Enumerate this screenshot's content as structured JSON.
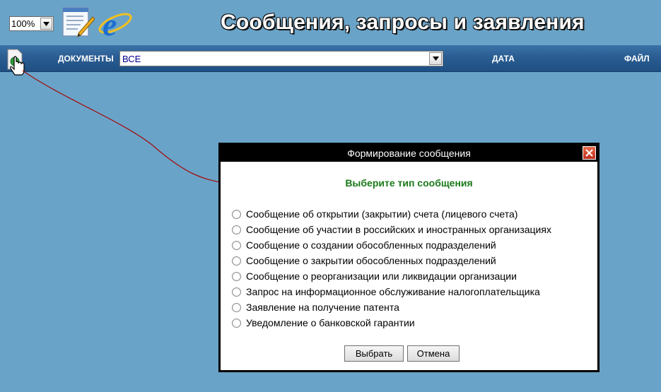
{
  "toolbar": {
    "zoom_value": "100%",
    "page_title": "Сообщения, запросы и заявления"
  },
  "header": {
    "documents_label": "ДОКУМЕНТЫ",
    "documents_filter_value": "ВСЕ",
    "date_label": "ДАТА",
    "file_label": "ФАЙЛ"
  },
  "dialog": {
    "title": "Формирование сообщения",
    "heading": "Выберите тип сообщения",
    "options": [
      "Сообщение об открытии (закрытии) счета (лицевого счета)",
      "Сообщение об участии в российских и иностранных организациях",
      "Сообщение о создании обособленных подразделений",
      "Сообщение о закрытии обособленных подразделений",
      "Сообщение о реорганизации или ликвидации организации",
      "Запрос на информационное обслуживание налогоплательщика",
      "Заявление на получение патента",
      "Уведомление о банковской гарантии"
    ],
    "select_button": "Выбрать",
    "cancel_button": "Отмена"
  },
  "icons": [
    "chevron-down-icon",
    "notepad-icon",
    "internet-explorer-icon",
    "new-document-icon",
    "hand-cursor-icon",
    "close-icon"
  ],
  "colors": {
    "background": "#6aa3c8",
    "header_bar": "#2a5d92",
    "dialog_heading": "#1a7a1a",
    "connector_arrow": "#a01010"
  }
}
